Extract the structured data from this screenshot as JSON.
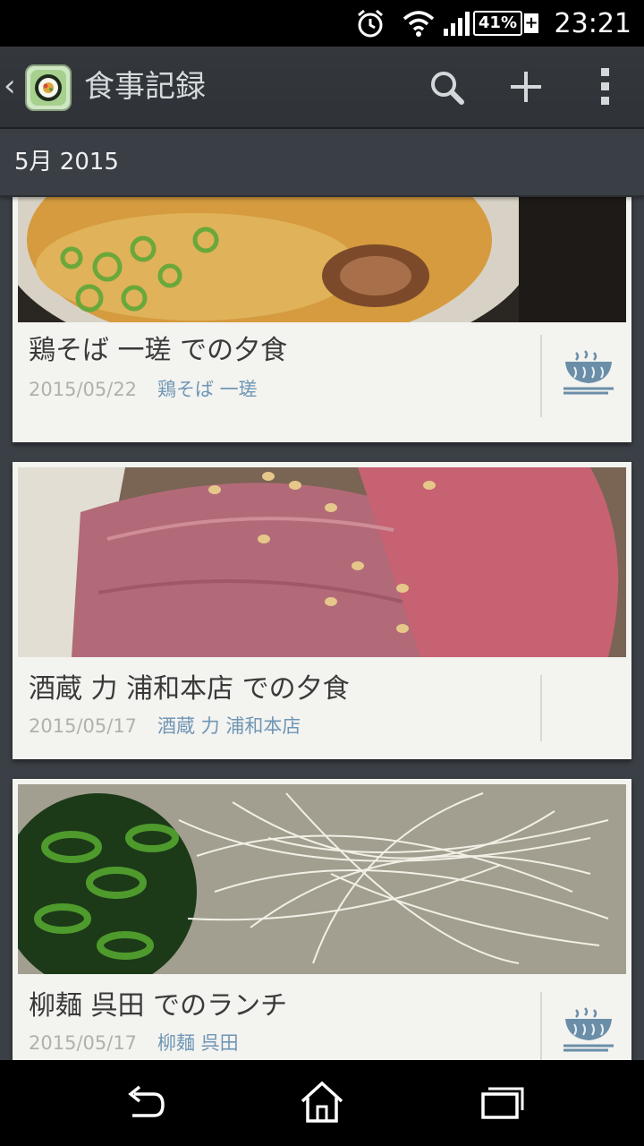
{
  "status_bar": {
    "battery_percent": "41%",
    "battery_plus": "+",
    "time": "23:21"
  },
  "action_bar": {
    "title": "食事記録",
    "icons": [
      "back-chevron-icon",
      "app-icon",
      "search-icon",
      "add-icon",
      "overflow-menu-icon"
    ]
  },
  "section": {
    "header": "5月 2015"
  },
  "entries": [
    {
      "title": "鶏そば 一瑳 での夕食",
      "date": "2015/05/22",
      "place": "鶏そば 一瑳",
      "photo": "ramen-soup-photo",
      "icon": "noodle-bowl-icon"
    },
    {
      "title": "酒蔵 力 浦和本店 での夕食",
      "date": "2015/05/17",
      "place": "酒蔵 力 浦和本店",
      "photo": "roast-beef-photo",
      "icon": ""
    },
    {
      "title": "柳麺 呉田 でのランチ",
      "date": "2015/05/17",
      "place": "柳麺 呉田",
      "photo": "ramen-green-onion-photo",
      "icon": "noodle-bowl-icon"
    }
  ],
  "nav_bar": {
    "icons": [
      "back-icon",
      "home-icon",
      "recent-apps-icon"
    ]
  }
}
